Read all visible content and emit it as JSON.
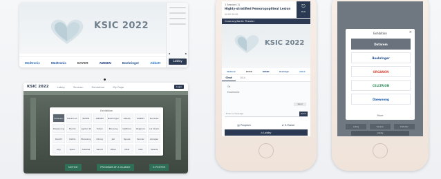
{
  "desktop_main": {
    "brand": "KSIC 2022",
    "brand_sub": "",
    "lobby_label": "Lobby",
    "sponsors": [
      "Medtronic",
      "Medtronic",
      "BAYER",
      "AMGEN",
      "Boehringer",
      "Abbott"
    ]
  },
  "desktop_hall": {
    "logo": "KSIC 2022",
    "nav": [
      "Lobby",
      "Session",
      "Exhibition",
      "My Page"
    ],
    "login_label": "Login",
    "exhibition_title": "Exhibition",
    "exhibitors": [
      "Dotarem",
      "Medtronic",
      "BAYER",
      "AMGEN",
      "Boehringer",
      "Abbott",
      "SANOFI",
      "Novartis",
      "Daewoong",
      "Hanmi",
      "Chong Kun Dang",
      "Yuhan",
      "Boryung",
      "Celltrion",
      "Organon",
      "LG Chem",
      "Daiichi",
      "Viatris",
      "Bukwang",
      "Ildong",
      "Jeil",
      "Kyowa",
      "Servier",
      "Alvogen",
      "Lilly",
      "Ipsen",
      "Astellas",
      "Sanofi",
      "Pfizer",
      "MSD",
      "GSK",
      "Takeda"
    ],
    "buttons": [
      "NOTICE",
      "PROGRAM AT A GLANCE",
      "E-POSTER"
    ]
  },
  "mobile_theater": {
    "small": "1 Session (1)",
    "title": "Highly-stratified Femoropopliteal Lesion",
    "meta": "00:00  00:00",
    "exit_label": "Exit",
    "theater": "Coronary/Aortic Theater",
    "brand": "KSIC 2022",
    "sponsors": [
      "Medtronic",
      "BAYER",
      "AMGEN",
      "Boehringer",
      "Abbott"
    ],
    "tabs": [
      "Chat",
      "Q&A"
    ],
    "chat_lines": [
      "Ok",
      "Enrollment"
    ],
    "chat_button": "Send",
    "input_placeholder": "Enter a message",
    "send_label": "Send",
    "quick": [
      "Program",
      "E-Poster"
    ],
    "lobby_label": "Lobby"
  },
  "mobile_exhibition": {
    "title": "Exhibition",
    "logos": [
      "Dotarem",
      "Boehringer",
      "ORGANON",
      "CELLTRION",
      "Daewoong"
    ],
    "more": "More",
    "nav": [
      "Lobby",
      "Session",
      "E-Poster"
    ],
    "lobby_label": "Lobby"
  },
  "colors": {
    "navy": "#2b3a52",
    "green": "#2f6f57"
  }
}
